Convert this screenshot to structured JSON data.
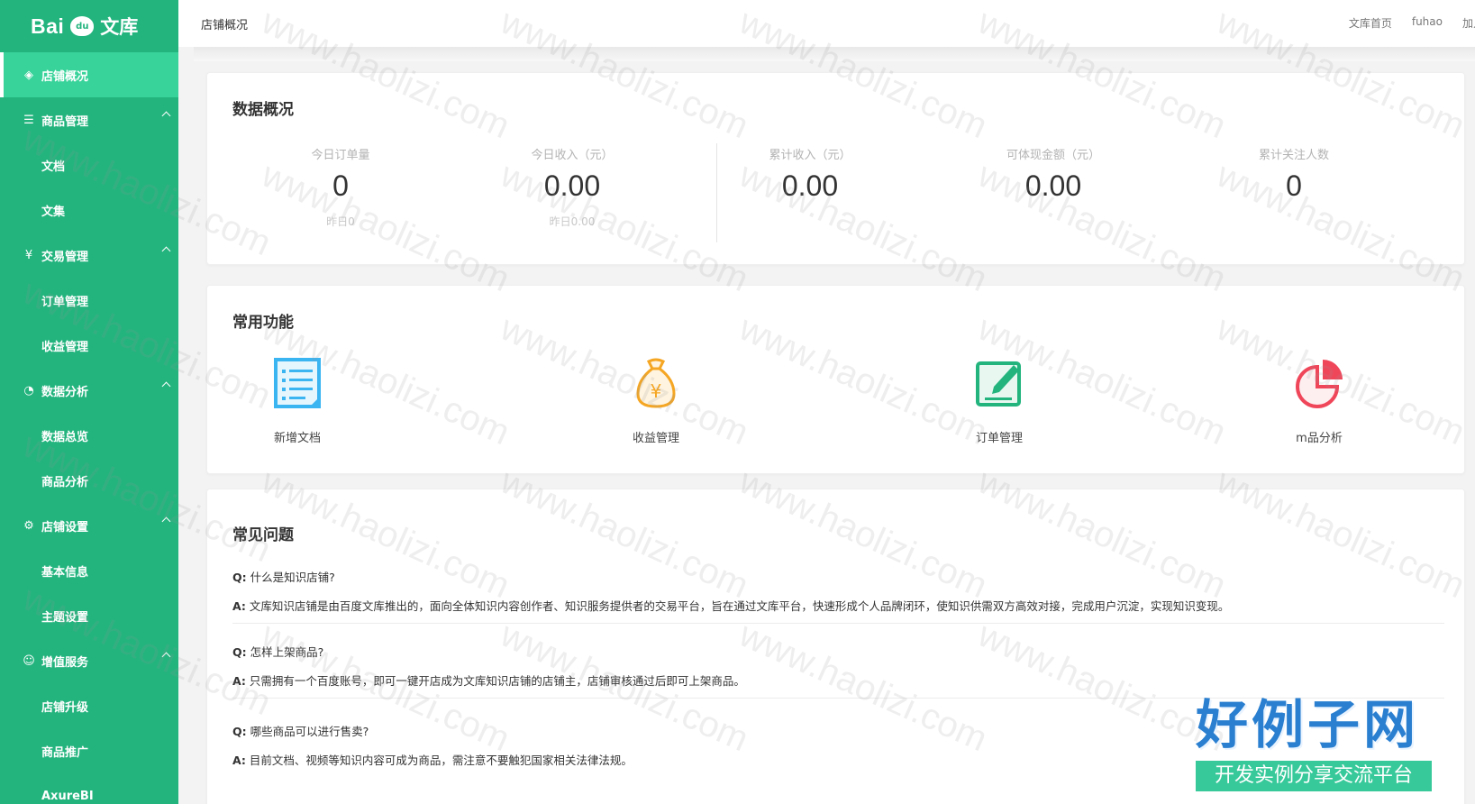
{
  "sidebar": {
    "logo": {
      "mark_left": "Bai",
      "mark_paw": "du",
      "mark_cn": "文库"
    },
    "items": [
      {
        "label": "店铺概况",
        "icon": "layers-icon",
        "type": "top",
        "active": true
      },
      {
        "label": "商品管理",
        "icon": "list-icon",
        "type": "top",
        "expanded": true
      },
      {
        "label": "文档",
        "type": "sub"
      },
      {
        "label": "文集",
        "type": "sub"
      },
      {
        "label": "交易管理",
        "icon": "yen-circle-icon",
        "type": "top",
        "expanded": true
      },
      {
        "label": "订单管理",
        "type": "sub"
      },
      {
        "label": "收益管理",
        "type": "sub"
      },
      {
        "label": "数据分析",
        "icon": "pie-chart-icon",
        "type": "top",
        "expanded": true
      },
      {
        "label": "数据总览",
        "type": "sub"
      },
      {
        "label": "商品分析",
        "type": "sub"
      },
      {
        "label": "店铺设置",
        "icon": "gear-icon",
        "type": "top",
        "expanded": true
      },
      {
        "label": "基本信息",
        "type": "sub"
      },
      {
        "label": "主题设置",
        "type": "sub"
      },
      {
        "label": "增值服务",
        "icon": "service-icon",
        "type": "top",
        "expanded": true
      },
      {
        "label": "店铺升级",
        "type": "sub"
      },
      {
        "label": "商品推广",
        "type": "sub"
      },
      {
        "label": "AxureBI",
        "type": "sub"
      }
    ]
  },
  "topbar": {
    "title": "店铺概况",
    "links": [
      "文库首页",
      "fuhao",
      "加入"
    ]
  },
  "stats": {
    "title": "数据概况",
    "items": [
      {
        "label": "今日订单量",
        "value": "0",
        "sub": "昨日0"
      },
      {
        "label": "今日收入（元）",
        "value": "0.00",
        "sub": "昨日0.00"
      },
      {
        "label": "累计收入（元）",
        "value": "0.00",
        "sub": ""
      },
      {
        "label": "可体现金额（元）",
        "value": "0.00",
        "sub": ""
      },
      {
        "label": "累计关注人数",
        "value": "0",
        "sub": ""
      }
    ]
  },
  "functions": {
    "title": "常用功能",
    "items": [
      {
        "label": "新增文档",
        "icon": "document-list-icon",
        "color": "#3bb4f2"
      },
      {
        "label": "收益管理",
        "icon": "money-bag-icon",
        "color": "#f5a623"
      },
      {
        "label": "订单管理",
        "icon": "edit-note-icon",
        "color": "#23b47e"
      },
      {
        "label": "m品分析",
        "icon": "pie-chart-icon",
        "color": "#f0465a"
      }
    ]
  },
  "faq": {
    "title": "常见问题",
    "q_tag": "Q:",
    "a_tag": "A:",
    "items": [
      {
        "q": "什么是知识店铺?",
        "a": "文库知识店铺是由百度文库推出的，面向全体知识内容创作者、知识服务提供者的交易平台，旨在通过文库平台，快速形成个人品牌闭环，使知识供需双方高效对接，完成用户沉淀，实现知识变现。"
      },
      {
        "q": "怎样上架商品?",
        "a": "只需拥有一个百度账号，即可一键开店成为文库知识店铺的店铺主，店铺审核通过后即可上架商品。"
      },
      {
        "q": "哪些商品可以进行售卖?",
        "a": "目前文档、视频等知识内容可成为商品，需注意不要触犯国家相关法律法规。"
      }
    ]
  },
  "watermark": {
    "text": "www.haolizi.com",
    "badge_top": "好例子网",
    "badge_bottom": "开发实例分享交流平台"
  },
  "colors": {
    "sidebar": "#23b47e",
    "sidebar_active": "#38d39a",
    "brand_blue": "#2a7fd0"
  }
}
